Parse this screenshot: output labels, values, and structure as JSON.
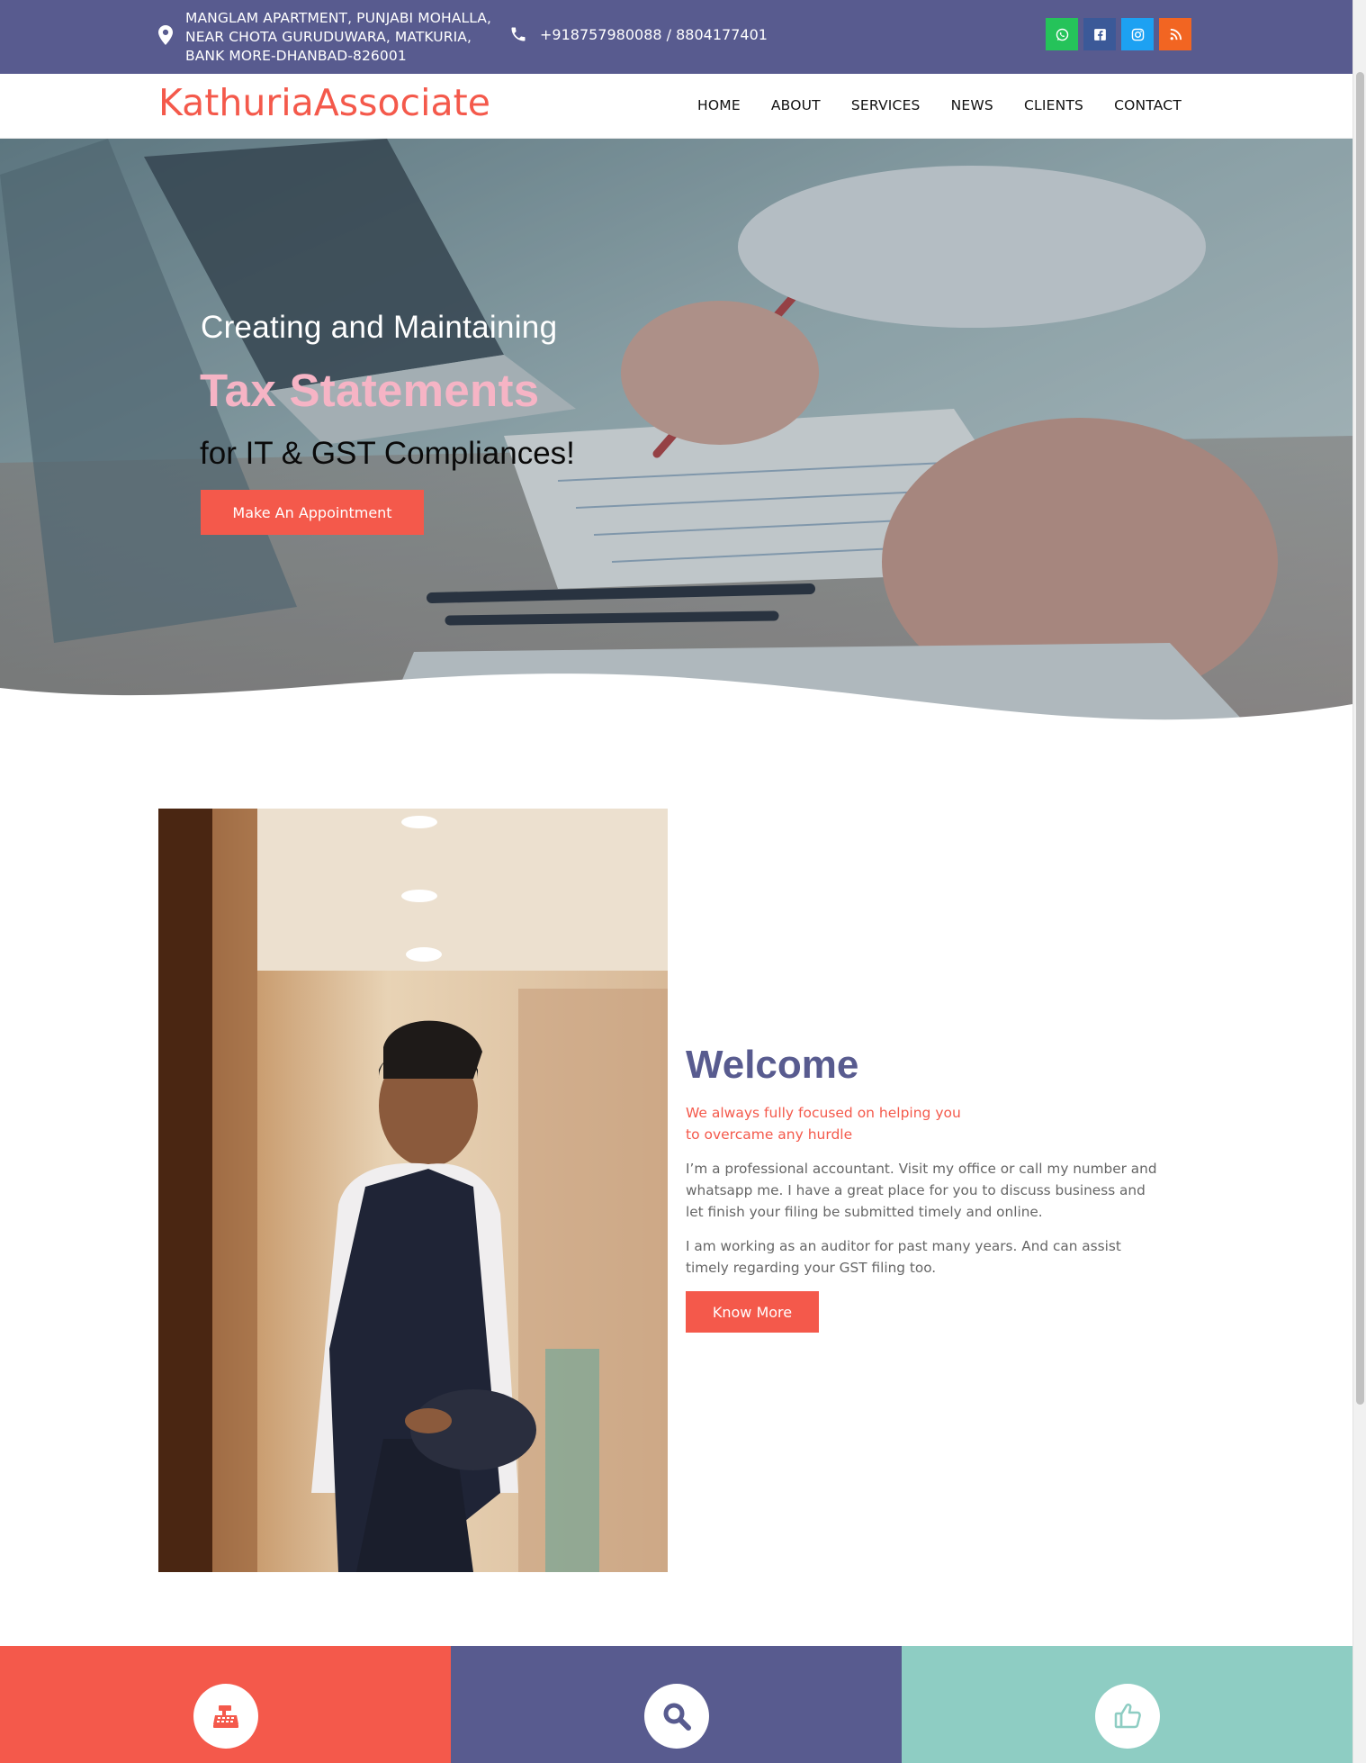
{
  "topbar": {
    "address_lines": [
      "MANGLAM APARTMENT, PUNJABI MOHALLA,",
      "NEAR CHOTA GURUDUWARA, MATKURIA,",
      "BANK MORE-DHANBAD-826001"
    ],
    "phone": "+918757980088 / 8804177401",
    "social": [
      {
        "icon": "whatsapp-icon",
        "color": "#25c35a"
      },
      {
        "icon": "facebook-icon",
        "color": "#3b5998"
      },
      {
        "icon": "instagram-icon",
        "color": "#1da1f2"
      },
      {
        "icon": "rss-icon",
        "color": "#f26522"
      }
    ]
  },
  "header": {
    "logo": "KathuriaAssociate",
    "nav": [
      "HOME",
      "ABOUT",
      "SERVICES",
      "NEWS",
      "CLIENTS",
      "CONTACT"
    ]
  },
  "hero": {
    "line1": "Creating and Maintaining",
    "line2": "Tax Statements",
    "line3": "for IT & GST Compliances!",
    "cta": "Make An Appointment"
  },
  "welcome": {
    "title": "Welcome",
    "tagline": "We always fully focused on helping you to overcame any hurdle",
    "para1": "I’m a professional accountant. Visit my office or call my number  and whatsapp me. I have a great place for you to discuss business and let finish your filing be submitted timely and online.",
    "para2": "I am working as an auditor for past many years. And can assist timely regarding your GST filing too.",
    "button": "Know More"
  },
  "features": [
    {
      "icon": "cash-register-icon",
      "color": "#f4594b"
    },
    {
      "icon": "search-icon",
      "color": "#585b8f"
    },
    {
      "icon": "thumbs-up-icon",
      "color": "#8ecdc3"
    }
  ],
  "colors": {
    "brand_purple": "#585b8f",
    "brand_coral": "#f4594b",
    "brand_pink": "#f6b4c5",
    "brand_teal": "#8ecdc3"
  }
}
